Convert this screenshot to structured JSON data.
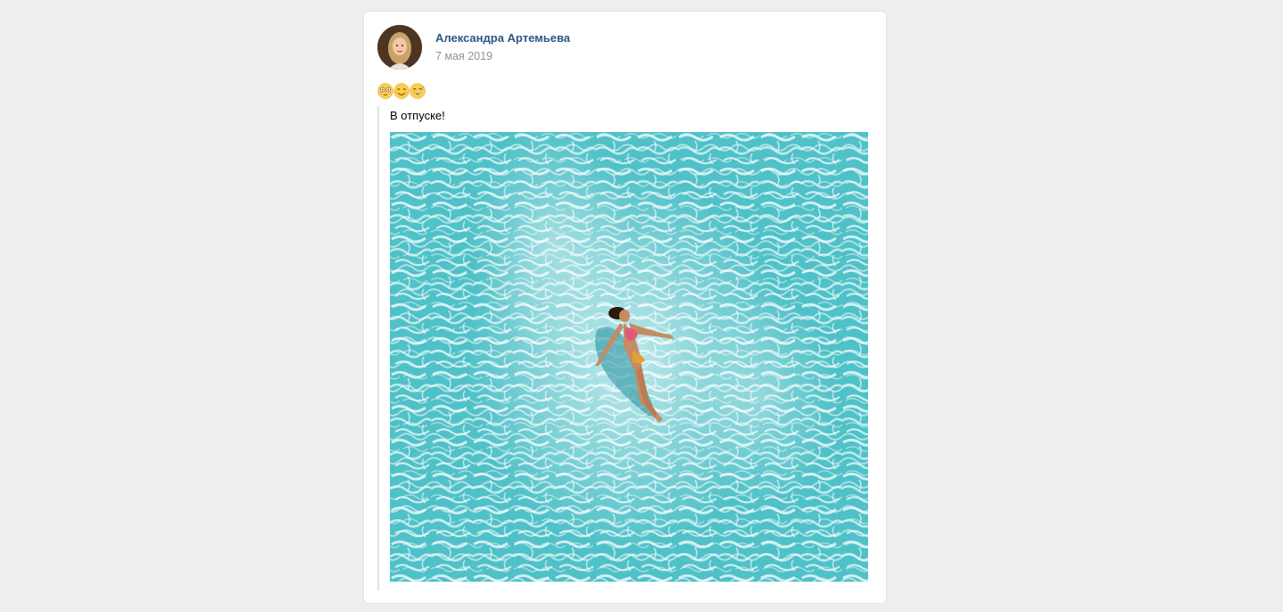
{
  "post": {
    "author": {
      "name": "Александра Артемьева",
      "avatar_icon": "user-avatar-photo"
    },
    "date": "7 мая 2019",
    "emojis": [
      "flushed-face-emoji",
      "smiling-face-emoji",
      "grinning-sweat-face-emoji"
    ],
    "repost": {
      "text": "В отпуске!",
      "photo": {
        "subject": "woman floating in turquoise water",
        "water_color": "#5ac8cd",
        "highlight_color": "#e8f7f8"
      }
    }
  },
  "colors": {
    "page_background": "#edeef0",
    "card_background": "#ffffff",
    "author_link": "#2a5885",
    "date_text": "#939393",
    "repost_border": "#dfe2e8"
  }
}
